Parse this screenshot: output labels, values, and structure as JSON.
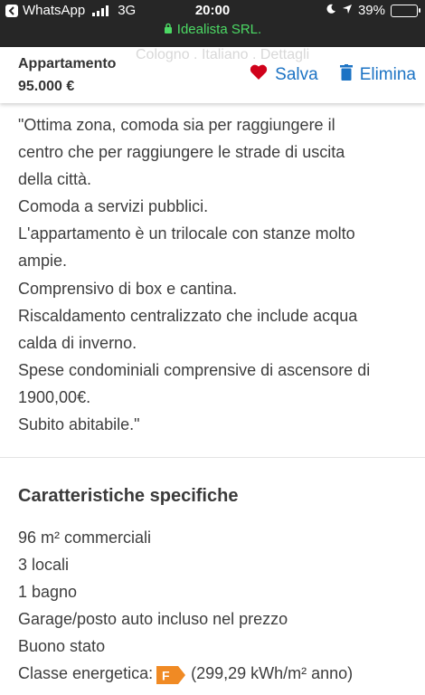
{
  "status_bar": {
    "back_app": "WhatsApp",
    "network": "3G",
    "time": "20:00",
    "battery": "39%",
    "battery_level": 0.39,
    "subtitle": "Idealista SRL."
  },
  "header": {
    "title": "Appartamento",
    "price": "95.000 €",
    "save_label": "Salva",
    "delete_label": "Elimina",
    "ghost_text": "Cologno . Italiano . Dettagli"
  },
  "description": {
    "lines": [
      "\"Ottima zona, comoda sia per raggiungere il",
      "centro che per raggiungere le strade di uscita",
      "della città.",
      "Comoda a servizi pubblici.",
      "L'appartamento è un trilocale con stanze molto",
      "ampie.",
      "Comprensivo di box e cantina.",
      "Riscaldamento centralizzato che include acqua",
      "calda di inverno.",
      "Spese condominiali comprensive di ascensore di",
      "1900,00€.",
      "Subito abitabile.\""
    ]
  },
  "features": {
    "title": "Caratteristiche specifiche",
    "items": [
      "96 m² commerciali",
      "3 locali",
      "1 bagno",
      "Garage/posto auto incluso nel prezzo",
      "Buono stato"
    ],
    "energy_label": "Classe energetica:",
    "energy_class": "F",
    "energy_value": "(299,29 kWh/m² anno)"
  },
  "colors": {
    "accent_blue": "#1c73c4",
    "heart_red": "#d0021b",
    "energy_orange": "#f08a24",
    "status_green": "#4cd964"
  }
}
